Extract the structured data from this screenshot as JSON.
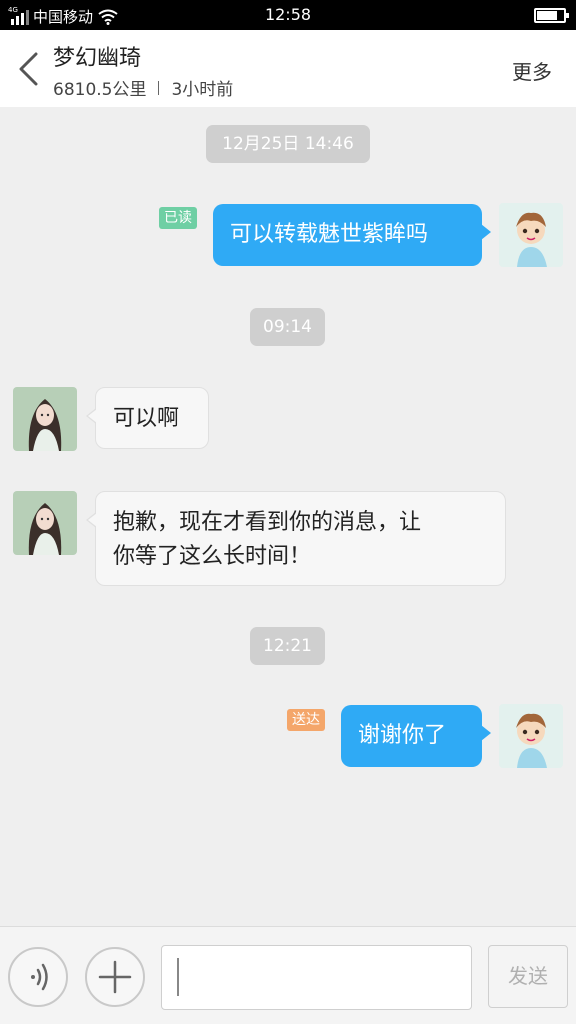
{
  "status_bar": {
    "network": "4G",
    "carrier": "中国移动",
    "time": "12:58"
  },
  "header": {
    "contact_name": "梦幻幽琦",
    "distance": "6810.5公里",
    "last_active": "3小时前",
    "more_label": "更多"
  },
  "messages": {
    "chip1": "12月25日 14:46",
    "m1_status": "已读",
    "m1_text": "可以转载魅世紫眸吗",
    "chip2": "09:14",
    "m2_text": "可以啊",
    "m3_line1": "抱歉，现在才看到你的消息，让",
    "m3_line2": "你等了这么长时间！",
    "chip3": "12:21",
    "m4_status": "送达",
    "m4_text": "谢谢你了"
  },
  "input_bar": {
    "message_value": "",
    "send_label": "发送"
  },
  "colors": {
    "my_bubble": "#2faaf5",
    "read_tag": "#6fcfa4",
    "delivered_tag": "#f4a66a"
  }
}
